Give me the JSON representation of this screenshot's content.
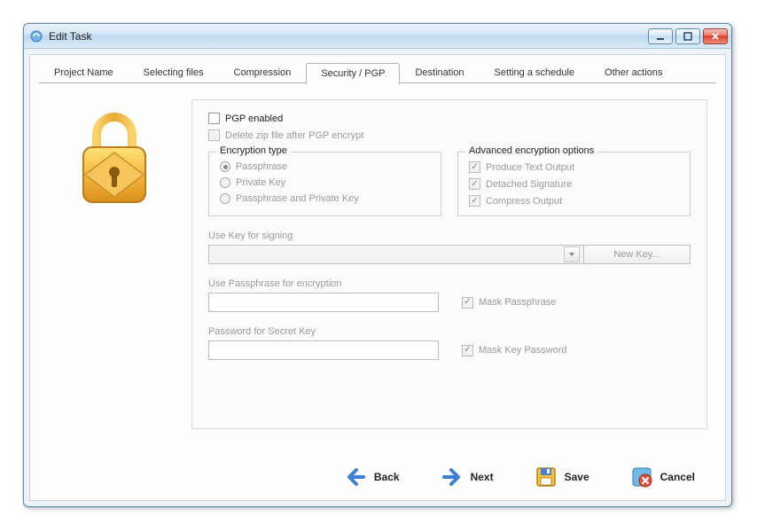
{
  "window": {
    "title": "Edit Task"
  },
  "tabs": [
    {
      "label": "Project Name",
      "active": false
    },
    {
      "label": "Selecting files",
      "active": false
    },
    {
      "label": "Compression",
      "active": false
    },
    {
      "label": "Security / PGP",
      "active": true
    },
    {
      "label": "Destination",
      "active": false
    },
    {
      "label": "Setting a schedule",
      "active": false
    },
    {
      "label": "Other actions",
      "active": false
    }
  ],
  "pgp": {
    "enabled_label": "PGP enabled",
    "enabled_checked": false,
    "delete_zip_label": "Delete zip file after PGP encrypt",
    "delete_zip_checked": false,
    "encryption_type": {
      "legend": "Encryption type",
      "options": [
        {
          "label": "Passphrase",
          "selected": true
        },
        {
          "label": "Private Key",
          "selected": false
        },
        {
          "label": "Passphrase and Private Key",
          "selected": false
        }
      ]
    },
    "advanced": {
      "legend": "Advanced encryption options",
      "options": [
        {
          "label": "Produce Text Output",
          "checked": true
        },
        {
          "label": "Detached Signature",
          "checked": true
        },
        {
          "label": "Compress Output",
          "checked": true
        }
      ]
    },
    "use_key_label": "Use Key for signing",
    "new_key_label": "New Key...",
    "use_passphrase_label": "Use Passphrase for encryption",
    "mask_passphrase_label": "Mask Passphrase",
    "mask_passphrase_checked": true,
    "password_secret_label": "Password for Secret Key",
    "mask_key_password_label": "Mask Key Password",
    "mask_key_password_checked": true
  },
  "footer": {
    "back": "Back",
    "next": "Next",
    "save": "Save",
    "cancel": "Cancel"
  }
}
